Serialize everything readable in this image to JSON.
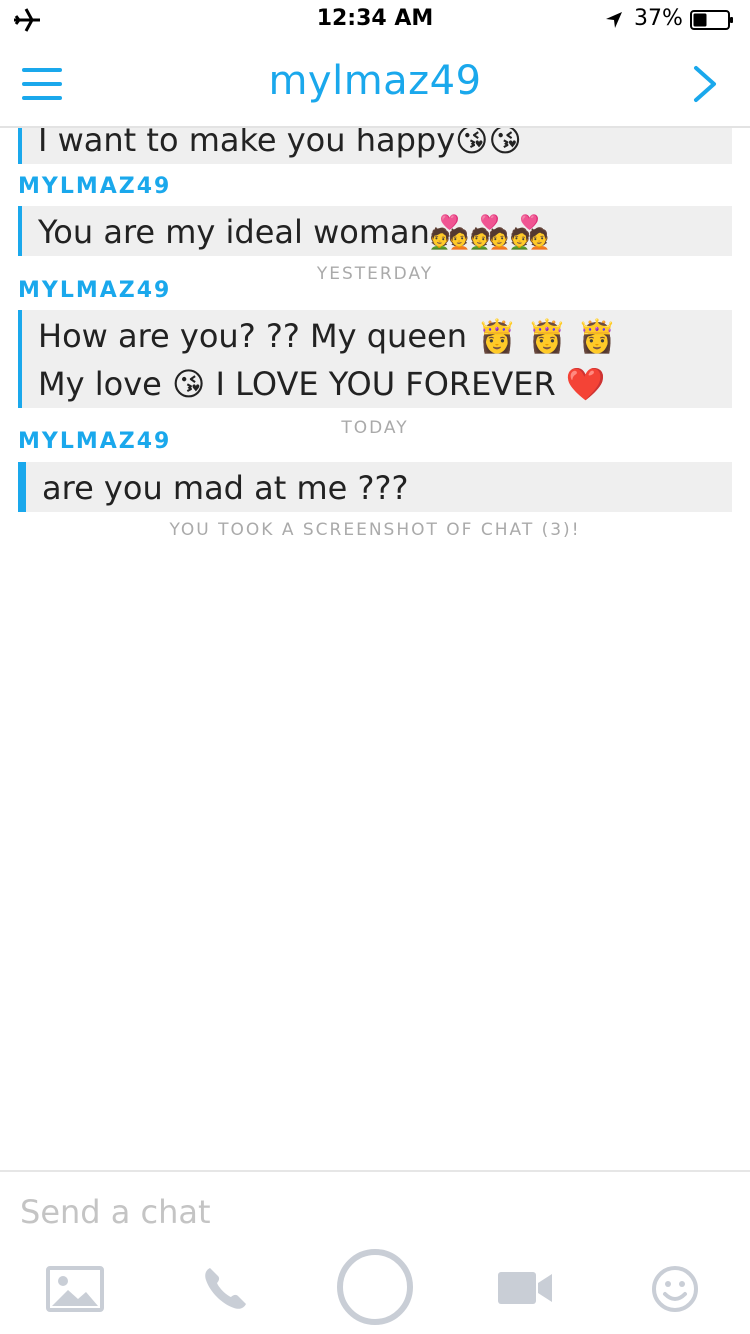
{
  "status_bar": {
    "time": "12:34 AM",
    "battery_percent": "37%"
  },
  "header": {
    "title": "mylmaz49"
  },
  "messages": [
    {
      "text": "I want to make you happy😘😘"
    },
    {
      "sender": "MYLMAZ49",
      "text": "You are my ideal woman💑💑💑"
    },
    {
      "divider": "YESTERDAY"
    },
    {
      "sender": "MYLMAZ49",
      "line1": "How are you? ?? My queen 👸 👸 👸",
      "line2": "My love 😘  I LOVE YOU FOREVER ❤️"
    },
    {
      "divider": "TODAY"
    },
    {
      "sender": "MYLMAZ49",
      "text": "are you mad at me ???"
    },
    {
      "notice": "YOU TOOK A SCREENSHOT OF CHAT (3)!"
    }
  ],
  "input": {
    "placeholder": "Send a chat"
  },
  "toolbar": {
    "icons": [
      "image-icon",
      "phone-icon",
      "capture-button",
      "video-icon",
      "emoji-icon"
    ]
  },
  "colors": {
    "accent": "#1aa8ec",
    "bubble": "#efefef",
    "muted": "#aaaaaa",
    "toolbar_icon": "#c9ced6"
  }
}
